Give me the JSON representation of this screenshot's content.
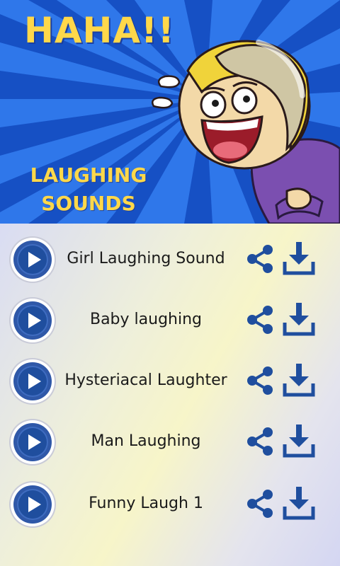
{
  "banner": {
    "title": "HAHA!!",
    "subtitle": "LAUGHING SOUNDS"
  },
  "colors": {
    "banner_blue": "#1d5fd6",
    "title_yellow": "#ffd84a",
    "icon_blue": "#1f4e9e"
  },
  "icons": {
    "play": "play-icon",
    "share": "share-icon",
    "download": "download-icon"
  },
  "sounds": [
    {
      "label": "Girl Laughing Sound"
    },
    {
      "label": "Baby laughing"
    },
    {
      "label": "Hysteriacal Laughter"
    },
    {
      "label": "Man Laughing"
    },
    {
      "label": "Funny Laugh 1"
    }
  ]
}
